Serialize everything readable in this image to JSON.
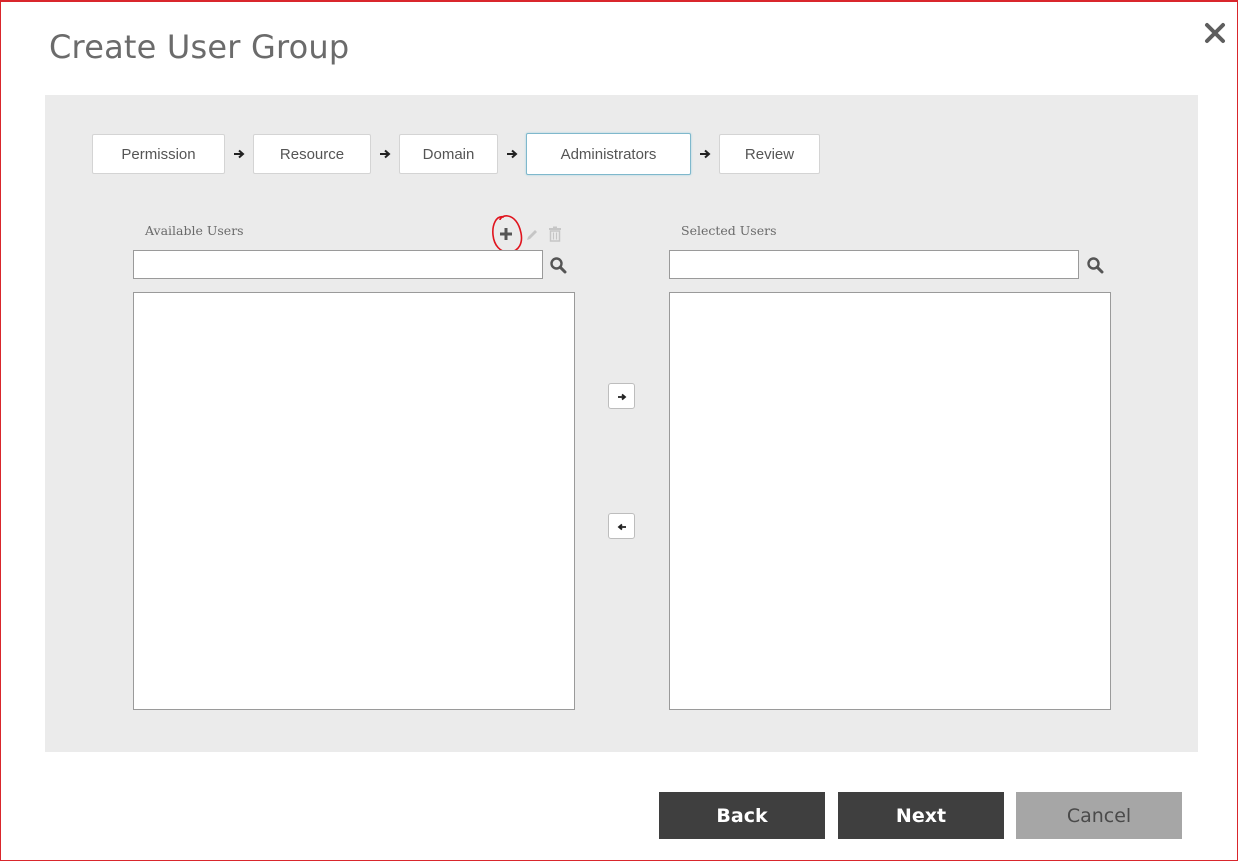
{
  "dialog": {
    "title": "Create User Group",
    "close_icon": "close-icon"
  },
  "wizard": {
    "steps": [
      {
        "label": "Permission",
        "active": false
      },
      {
        "label": "Resource",
        "active": false
      },
      {
        "label": "Domain",
        "active": false
      },
      {
        "label": "Administrators",
        "active": true
      },
      {
        "label": "Review",
        "active": false
      }
    ],
    "separator_icon": "arrow-right-icon"
  },
  "available_users": {
    "label": "Available Users",
    "search_value": "",
    "search_placeholder": "",
    "items": [],
    "toolbar": {
      "add_icon": "plus-icon",
      "edit_icon": "pencil-icon",
      "delete_icon": "trash-icon"
    }
  },
  "selected_users": {
    "label": "Selected Users",
    "search_value": "",
    "search_placeholder": "",
    "items": []
  },
  "transfer": {
    "move_right_icon": "arrow-right-icon",
    "move_left_icon": "arrow-left-icon"
  },
  "footer": {
    "back_label": "Back",
    "next_label": "Next",
    "cancel_label": "Cancel"
  },
  "annotation": {
    "description": "red hand-drawn circle around add button",
    "color": "#e0141e"
  },
  "colors": {
    "frame_border": "#d9262c",
    "panel_bg": "#ebebeb",
    "primary_button": "#3f3f3f",
    "disabled_button": "#a6a6a6",
    "active_step_border": "#7fb8cc"
  }
}
